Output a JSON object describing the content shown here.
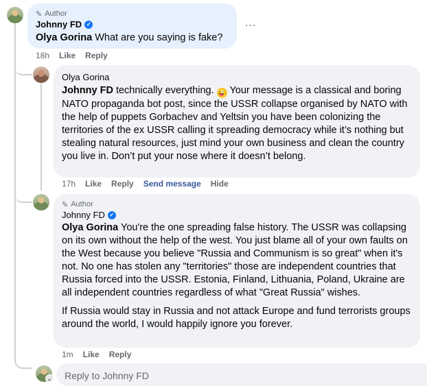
{
  "comments": [
    {
      "author_tag": "Author",
      "name": "Johnny FD",
      "mention": "Olya Gorina",
      "text": "What are you saying is fake?",
      "time": "18h",
      "like": "Like",
      "reply": "Reply",
      "more": "..."
    },
    {
      "name": "Olya Gorina",
      "mention": "Johnny FD",
      "text_before_emoji": "technically everything.",
      "emoji": "wink-tongue-emoji",
      "text_after_emoji": "Your message is a classical and boring NATO propaganda bot post, since the USSR collapse organised by NATO with the help of puppets Gorbachev and Yeltsin you have been colonizing the territories of the ex USSR calling it spreading democracy while it’s nothing but stealing natural resources, just mind your own business and clean the country you live in. Don’t put your nose where it doesn’t belong.",
      "time": "17h",
      "like": "Like",
      "reply": "Reply",
      "send_message": "Send message",
      "hide": "Hide"
    },
    {
      "author_tag": "Author",
      "name": "Johnny FD",
      "mention": "Olya Gorina",
      "text": "You're the one spreading false history. The USSR was collapsing on its own without the help of the west. You just blame all of your own faults on the West because you believe \"Russia and Communism is so great\" when it's not. No one has stolen any \"territories\" those are independent countries that Russia forced into the USSR. Estonia, Finland, Lithuania, Poland, Ukraine are all independent countries regardless of what \"Great Russia\" wishes.",
      "text2": "If Russia would stay in Russia and not attack Europe and fund terrorists groups around the world, I would happily ignore you forever.",
      "time": "1m",
      "like": "Like",
      "reply": "Reply"
    }
  ],
  "reply_box": {
    "placeholder": "Reply to Johnny FD"
  }
}
